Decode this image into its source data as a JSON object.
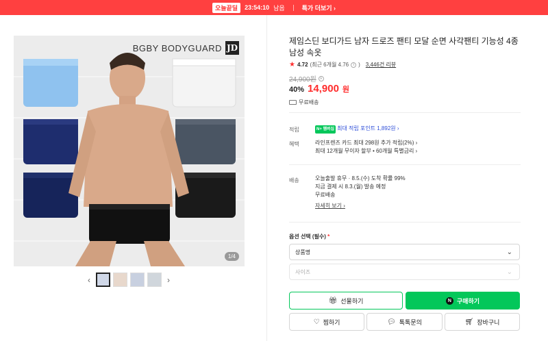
{
  "banner": {
    "tag": "오늘끝딜",
    "timer": "23:54:10",
    "remaining": "남음",
    "more": "특가 더보기 ›"
  },
  "product": {
    "brand": "BGBY BODYGUARD",
    "brand_mark": "JD",
    "image_counter": "1/4",
    "title": "제임스딘 보디가드 남자 드로즈 팬티 모달 순면 사각팬티 기능성 4종 남성 속옷",
    "rating": "4.72",
    "rating_recent": "(최근 6개월 4.76",
    "reviews": "3,446건 리뷰",
    "original_price": "24,900원",
    "discount": "40%",
    "price": "14,900",
    "won": "원",
    "free_shipping": "무료배송"
  },
  "info": {
    "point_label": "적립",
    "npay_badge": "N+ 멤버십",
    "point_text": "최대 적립 포인트 1,892원 ›",
    "benefit_label": "혜택",
    "benefit_line1": "라인프렌즈 카드 최대 298원 추가 적립(2%) ›",
    "benefit_line2": "최대 12개월 무이자 할부 • 60개월 특별금리 ›",
    "delivery_label": "배송",
    "delivery_line1": "오늘출발 휴무 · 8.5.(수) 도착 확률 99%",
    "delivery_line2": "지금 결제 시 8.3.(월) 발송 예정",
    "delivery_line3": "무료배송",
    "detail_link": "자세히 보기 ›"
  },
  "options": {
    "label": "옵션 선택 (필수)",
    "required_mark": "*",
    "select1": "상품명",
    "select2": "사이즈"
  },
  "buttons": {
    "gift": "선물하기",
    "buy": "구매하기",
    "wish": "찜하기",
    "talk": "톡톡문의",
    "cart": "장바구니"
  },
  "colors": {
    "accent_red": "#ff4040",
    "buy_green": "#03c75a"
  }
}
